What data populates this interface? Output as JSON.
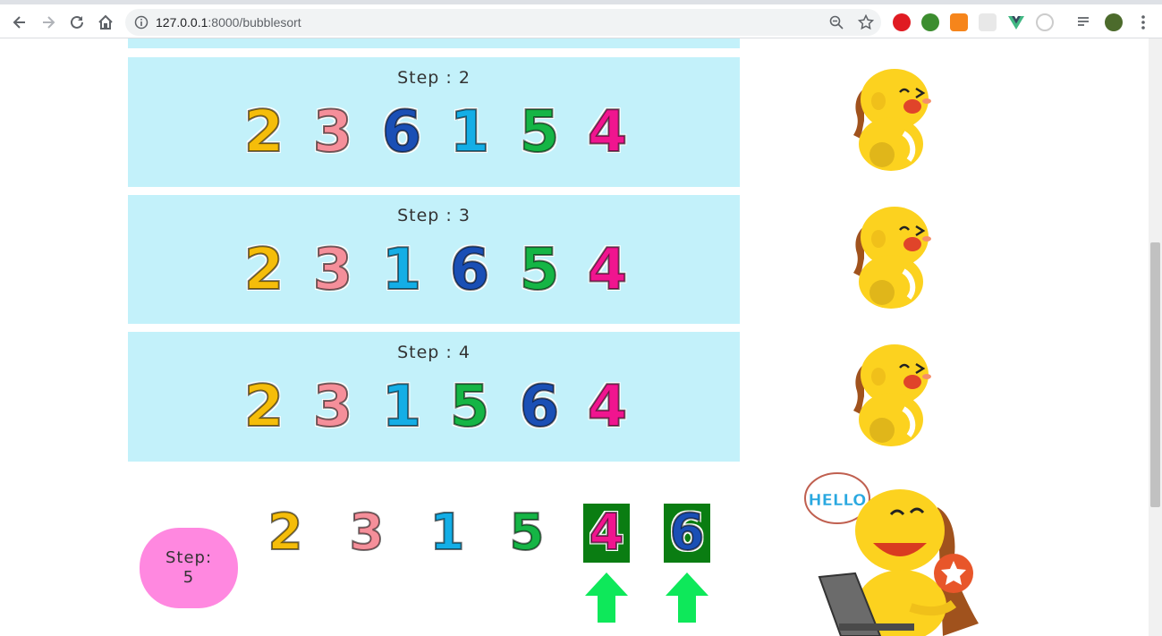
{
  "browser": {
    "url_host": "127.0.0.1",
    "url_path": ":8000/bubblesort"
  },
  "steps": [
    {
      "title": "Step : 2",
      "digits": [
        {
          "value": "2",
          "color": "#f5bd0a"
        },
        {
          "value": "3",
          "color": "#f58f9a"
        },
        {
          "value": "6",
          "color": "#1a4fb5"
        },
        {
          "value": "1",
          "color": "#14aee6"
        },
        {
          "value": "5",
          "color": "#15b545"
        },
        {
          "value": "4",
          "color": "#f0158f"
        }
      ]
    },
    {
      "title": "Step : 3",
      "digits": [
        {
          "value": "2",
          "color": "#f5bd0a"
        },
        {
          "value": "3",
          "color": "#f58f9a"
        },
        {
          "value": "1",
          "color": "#14aee6"
        },
        {
          "value": "6",
          "color": "#1a4fb5"
        },
        {
          "value": "5",
          "color": "#15b545"
        },
        {
          "value": "4",
          "color": "#f0158f"
        }
      ]
    },
    {
      "title": "Step : 4",
      "digits": [
        {
          "value": "2",
          "color": "#f5bd0a"
        },
        {
          "value": "3",
          "color": "#f58f9a"
        },
        {
          "value": "1",
          "color": "#14aee6"
        },
        {
          "value": "5",
          "color": "#15b545"
        },
        {
          "value": "6",
          "color": "#1a4fb5"
        },
        {
          "value": "4",
          "color": "#f0158f"
        }
      ]
    }
  ],
  "current": {
    "label": "Step:",
    "number": "5",
    "digits": [
      {
        "value": "2",
        "color": "#f5bd0a",
        "highlight": false
      },
      {
        "value": "3",
        "color": "#f58f9a",
        "highlight": false
      },
      {
        "value": "1",
        "color": "#14aee6",
        "highlight": false
      },
      {
        "value": "5",
        "color": "#15b545",
        "highlight": false
      },
      {
        "value": "4",
        "color": "#f0158f",
        "highlight": true
      },
      {
        "value": "6",
        "color": "#1a4fb5",
        "highlight": true
      }
    ],
    "arrow_color": "#0ee85a",
    "highlight_color": "#0a7d12"
  },
  "mascot": {
    "speech": "HELLO"
  }
}
